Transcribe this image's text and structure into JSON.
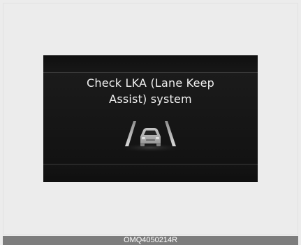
{
  "display": {
    "message_line_1": "Check LKA (Lane Keep",
    "message_line_2": "Assist) system",
    "icon": "lka-lane-car-icon"
  },
  "footer": {
    "code": "OMQ4050214R"
  },
  "colors": {
    "background": "#ececec",
    "display_bg": "#121212",
    "text": "#f0f0f0",
    "footer_bg": "#7d7d7d"
  }
}
